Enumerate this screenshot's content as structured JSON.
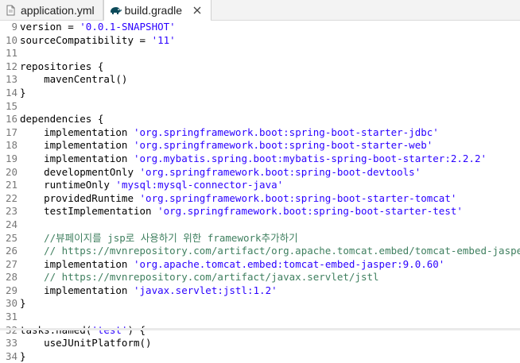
{
  "tabs": [
    {
      "label": "application.yml",
      "active": false
    },
    {
      "label": "build.gradle",
      "active": true
    }
  ],
  "lines": [
    {
      "n": "9",
      "parts": [
        [
          "plain",
          "version = "
        ],
        [
          "str",
          "'0.0.1-SNAPSHOT'"
        ]
      ]
    },
    {
      "n": "10",
      "parts": [
        [
          "plain",
          "sourceCompatibility = "
        ],
        [
          "str",
          "'11'"
        ]
      ]
    },
    {
      "n": "11",
      "parts": []
    },
    {
      "n": "12",
      "parts": [
        [
          "plain",
          "repositories {"
        ]
      ]
    },
    {
      "n": "13",
      "parts": [
        [
          "plain",
          "    mavenCentral()"
        ]
      ]
    },
    {
      "n": "14",
      "parts": [
        [
          "plain",
          "}"
        ]
      ]
    },
    {
      "n": "15",
      "parts": []
    },
    {
      "n": "16",
      "parts": [
        [
          "plain",
          "dependencies {"
        ]
      ]
    },
    {
      "n": "17",
      "parts": [
        [
          "plain",
          "    implementation "
        ],
        [
          "str",
          "'org.springframework.boot:spring-boot-starter-jdbc'"
        ]
      ]
    },
    {
      "n": "18",
      "parts": [
        [
          "plain",
          "    implementation "
        ],
        [
          "str",
          "'org.springframework.boot:spring-boot-starter-web'"
        ]
      ]
    },
    {
      "n": "19",
      "parts": [
        [
          "plain",
          "    implementation "
        ],
        [
          "str",
          "'org.mybatis.spring.boot:mybatis-spring-boot-starter:2.2.2'"
        ]
      ]
    },
    {
      "n": "20",
      "parts": [
        [
          "plain",
          "    developmentOnly "
        ],
        [
          "str",
          "'org.springframework.boot:spring-boot-devtools'"
        ]
      ]
    },
    {
      "n": "21",
      "parts": [
        [
          "plain",
          "    runtimeOnly "
        ],
        [
          "str",
          "'mysql:mysql-connector-java'"
        ]
      ]
    },
    {
      "n": "22",
      "parts": [
        [
          "plain",
          "    providedRuntime "
        ],
        [
          "str",
          "'org.springframework.boot:spring-boot-starter-tomcat'"
        ]
      ]
    },
    {
      "n": "23",
      "parts": [
        [
          "plain",
          "    testImplementation "
        ],
        [
          "str",
          "'org.springframework.boot:spring-boot-starter-test'"
        ]
      ]
    },
    {
      "n": "24",
      "parts": []
    },
    {
      "n": "25",
      "parts": [
        [
          "cm",
          "    //뷰페이지를 jsp로 사용하기 위한 framework추가하기"
        ]
      ]
    },
    {
      "n": "26",
      "parts": [
        [
          "cm",
          "    // https://mvnrepository.com/artifact/org.apache.tomcat.embed/tomcat-embed-jasper"
        ]
      ]
    },
    {
      "n": "27",
      "parts": [
        [
          "plain",
          "    implementation "
        ],
        [
          "str",
          "'org.apache.tomcat.embed:tomcat-embed-jasper:9.0.60'"
        ]
      ]
    },
    {
      "n": "28",
      "parts": [
        [
          "cm",
          "    // https://mvnrepository.com/artifact/javax.servlet/jstl"
        ]
      ]
    },
    {
      "n": "29",
      "parts": [
        [
          "plain",
          "    implementation "
        ],
        [
          "str",
          "'javax.servlet:jstl:1.2'"
        ]
      ]
    },
    {
      "n": "30",
      "parts": [
        [
          "plain",
          "}"
        ]
      ]
    },
    {
      "n": "31",
      "parts": []
    },
    {
      "n": "32",
      "parts": [
        [
          "plain",
          "tasks.named("
        ],
        [
          "str",
          "'test'"
        ],
        [
          "plain",
          ") {"
        ]
      ]
    },
    {
      "n": "33",
      "parts": [
        [
          "plain",
          "    useJUnitPlatform()"
        ]
      ]
    },
    {
      "n": "34",
      "parts": [
        [
          "plain",
          "}"
        ]
      ]
    }
  ],
  "colors": {
    "string": "#2a00ff",
    "comment": "#3f7f5f",
    "line_number": "#787878"
  },
  "icons": {
    "tab0": "yml-file-icon",
    "tab1": "gradle-elephant-icon",
    "close": "close-icon"
  }
}
